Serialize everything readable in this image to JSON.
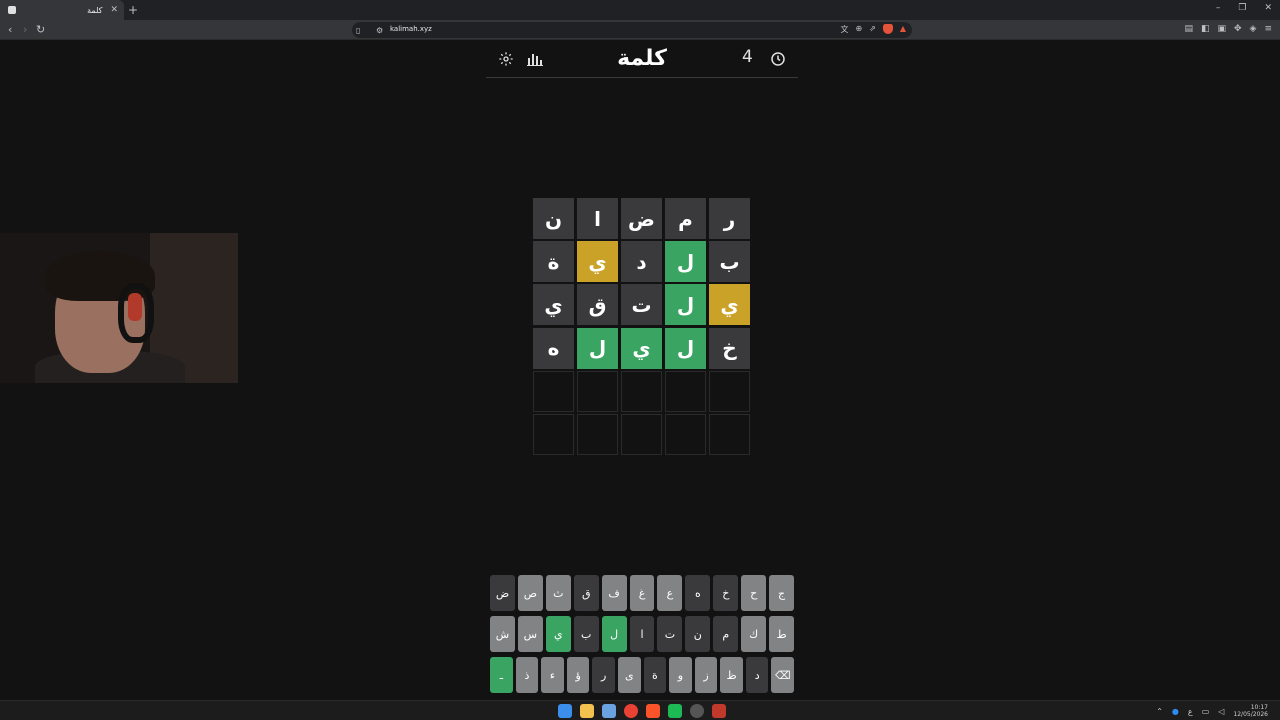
{
  "browser": {
    "tab_title": "كلمة",
    "url": "kalimah.xyz"
  },
  "game": {
    "title": "كلمة",
    "counter": "4"
  },
  "board": [
    [
      {
        "l": "ر",
        "s": "absent"
      },
      {
        "l": "م",
        "s": "absent"
      },
      {
        "l": "ض",
        "s": "absent"
      },
      {
        "l": "ا",
        "s": "absent"
      },
      {
        "l": "ن",
        "s": "absent"
      }
    ],
    [
      {
        "l": "ب",
        "s": "absent"
      },
      {
        "l": "ل",
        "s": "correct"
      },
      {
        "l": "د",
        "s": "absent"
      },
      {
        "l": "ي",
        "s": "present"
      },
      {
        "l": "ة",
        "s": "absent"
      }
    ],
    [
      {
        "l": "ي",
        "s": "present"
      },
      {
        "l": "ل",
        "s": "correct"
      },
      {
        "l": "ت",
        "s": "absent"
      },
      {
        "l": "ق",
        "s": "absent"
      },
      {
        "l": "ي",
        "s": "absent"
      }
    ],
    [
      {
        "l": "خ",
        "s": "absent"
      },
      {
        "l": "ل",
        "s": "correct"
      },
      {
        "l": "ي",
        "s": "correct"
      },
      {
        "l": "ل",
        "s": "correct"
      },
      {
        "l": "ه",
        "s": "absent"
      }
    ],
    [
      {
        "l": "",
        "s": "empty"
      },
      {
        "l": "",
        "s": "empty"
      },
      {
        "l": "",
        "s": "empty"
      },
      {
        "l": "",
        "s": "empty"
      },
      {
        "l": "",
        "s": "empty"
      }
    ],
    [
      {
        "l": "",
        "s": "empty"
      },
      {
        "l": "",
        "s": "empty"
      },
      {
        "l": "",
        "s": "empty"
      },
      {
        "l": "",
        "s": "empty"
      },
      {
        "l": "",
        "s": "empty"
      }
    ]
  ],
  "keyboard": {
    "row1": [
      {
        "k": "ج",
        "s": "unused"
      },
      {
        "k": "ح",
        "s": "unused"
      },
      {
        "k": "خ",
        "s": "absent"
      },
      {
        "k": "ه",
        "s": "absent"
      },
      {
        "k": "ع",
        "s": "unused"
      },
      {
        "k": "غ",
        "s": "unused"
      },
      {
        "k": "ف",
        "s": "unused"
      },
      {
        "k": "ق",
        "s": "absent"
      },
      {
        "k": "ث",
        "s": "unused"
      },
      {
        "k": "ص",
        "s": "unused"
      },
      {
        "k": "ض",
        "s": "absent"
      }
    ],
    "row2": [
      {
        "k": "ط",
        "s": "unused"
      },
      {
        "k": "ك",
        "s": "unused"
      },
      {
        "k": "م",
        "s": "absent"
      },
      {
        "k": "ن",
        "s": "absent"
      },
      {
        "k": "ت",
        "s": "absent"
      },
      {
        "k": "ا",
        "s": "absent"
      },
      {
        "k": "ل",
        "s": "correct"
      },
      {
        "k": "ب",
        "s": "absent"
      },
      {
        "k": "ي",
        "s": "correct"
      },
      {
        "k": "س",
        "s": "unused"
      },
      {
        "k": "ش",
        "s": "unused"
      }
    ],
    "row3": [
      {
        "k": "⌫",
        "s": "unused",
        "name": "backspace-key"
      },
      {
        "k": "د",
        "s": "absent"
      },
      {
        "k": "ظ",
        "s": "unused"
      },
      {
        "k": "ز",
        "s": "unused"
      },
      {
        "k": "و",
        "s": "unused"
      },
      {
        "k": "ة",
        "s": "absent"
      },
      {
        "k": "ى",
        "s": "unused"
      },
      {
        "k": "ر",
        "s": "absent"
      },
      {
        "k": "ؤ",
        "s": "unused"
      },
      {
        "k": "ء",
        "s": "unused"
      },
      {
        "k": "ذ",
        "s": "unused"
      },
      {
        "k": "ـ",
        "s": "correct",
        "name": "enter-key"
      }
    ]
  },
  "taskbar": {
    "time": "10:17",
    "date": "12/05/2026",
    "lang": "ع"
  },
  "colors": {
    "correct": "#3aa563",
    "present": "#c9a227",
    "absent": "#3a3a3c",
    "unused": "#818384"
  }
}
